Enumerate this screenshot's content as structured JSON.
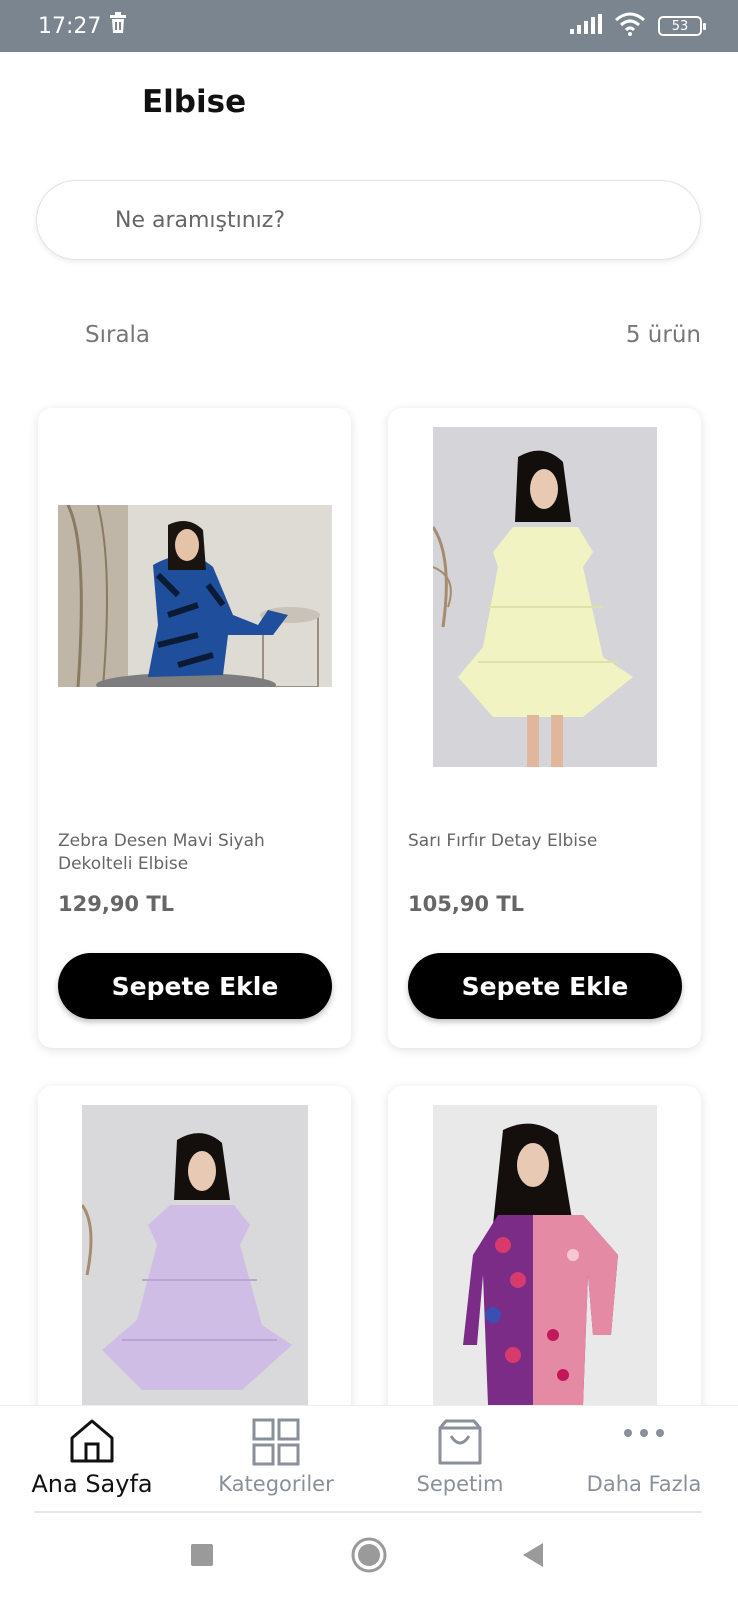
{
  "status_bar": {
    "time": "17:27",
    "battery": "53",
    "icons": [
      "trash-icon",
      "signal-icon",
      "wifi-icon",
      "battery-icon"
    ]
  },
  "header": {
    "title": "Elbise"
  },
  "search": {
    "placeholder": "Ne aramıştınız?"
  },
  "toolbar": {
    "sort_label": "Sırala",
    "count_label": "5 ürün"
  },
  "products": [
    {
      "title": "Zebra Desen Mavi Siyah Dekolteli Elbise",
      "price": "129,90 TL",
      "button": "Sepete Ekle"
    },
    {
      "title": "Sarı Fırfır Detay Elbise",
      "price": "105,90 TL",
      "button": "Sepete Ekle"
    },
    {
      "title": "",
      "price": "",
      "button": ""
    },
    {
      "title": "",
      "price": "",
      "button": ""
    }
  ],
  "bottom_nav": {
    "items": [
      {
        "label": "Ana Sayfa",
        "icon": "home-icon",
        "active": true
      },
      {
        "label": "Kategoriler",
        "icon": "grid-icon",
        "active": false
      },
      {
        "label": "Sepetim",
        "icon": "shopping-bag-icon",
        "active": false
      },
      {
        "label": "Daha Fazla",
        "icon": "more-icon",
        "active": false
      }
    ]
  },
  "colors": {
    "status_bar": "#7a858f",
    "primary_button": "#000000",
    "text_muted": "#777777"
  }
}
